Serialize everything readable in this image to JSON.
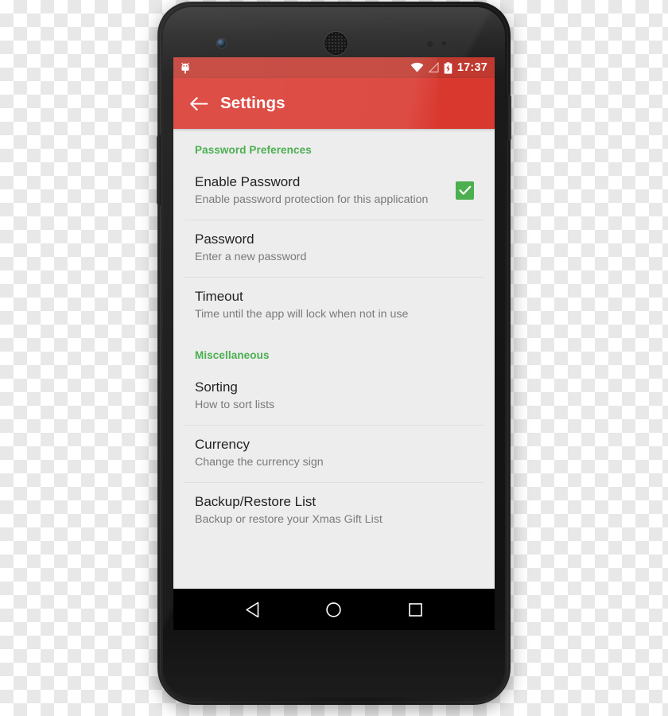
{
  "device": {
    "name": "android-smartphone",
    "hardware": {
      "front_camera": "front-camera",
      "earpiece": "earpiece-speaker",
      "proximity_sensor": "proximity-sensor",
      "light_sensor": "light-sensor",
      "volume_rocker": "volume-rocker",
      "power_button": "power-button"
    }
  },
  "colors": {
    "status_bar": "#c0392f",
    "app_bar": "#d9382f",
    "accent_green": "#4caf50",
    "screen_background": "#ededed",
    "title_text": "#222222",
    "summary_text": "#7a7a7a",
    "divider": "#dedede",
    "nav_bar": "#000000"
  },
  "status_bar": {
    "notification_icon": "android-robot-icon",
    "wifi_icon": "wifi-icon",
    "signal_icon": "cell-signal-icon",
    "battery_icon": "battery-charging-icon",
    "clock": "17:37"
  },
  "app_bar": {
    "back_icon": "back-arrow-icon",
    "title": "Settings"
  },
  "sections": [
    {
      "header": "Password Preferences",
      "items": [
        {
          "title": "Enable Password",
          "summary": "Enable password protection for this application",
          "control": "checkbox",
          "checked": true,
          "name": "enable-password"
        },
        {
          "title": "Password",
          "summary": "Enter a new password",
          "control": "none",
          "name": "password"
        },
        {
          "title": "Timeout",
          "summary": "Time until the app will lock when not in use",
          "control": "none",
          "name": "timeout"
        }
      ]
    },
    {
      "header": "Miscellaneous",
      "items": [
        {
          "title": "Sorting",
          "summary": "How to sort lists",
          "control": "none",
          "name": "sorting"
        },
        {
          "title": "Currency",
          "summary": "Change the currency sign",
          "control": "none",
          "name": "currency"
        },
        {
          "title": "Backup/Restore List",
          "summary": "Backup or restore your Xmas Gift List",
          "control": "none",
          "name": "backup-restore-list"
        }
      ]
    }
  ],
  "nav_bar": {
    "back": "back-triangle-icon",
    "home": "home-circle-icon",
    "recents": "recents-square-icon"
  }
}
